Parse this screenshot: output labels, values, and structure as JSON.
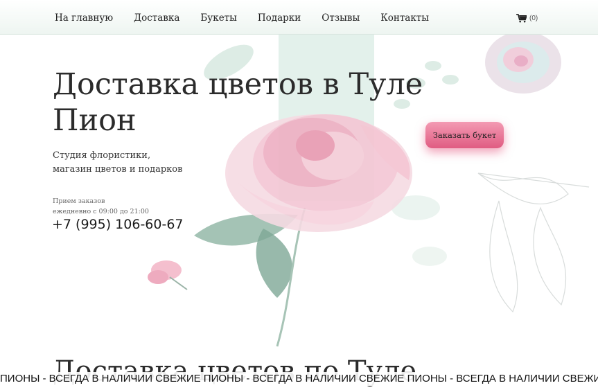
{
  "nav": {
    "items": [
      {
        "label": "На главную"
      },
      {
        "label": "Доставка"
      },
      {
        "label": "Букеты"
      },
      {
        "label": "Подарки"
      },
      {
        "label": "Отзывы"
      },
      {
        "label": "Контакты"
      }
    ],
    "cart_count": "(0)",
    "cart_icon": "shopping-cart-icon"
  },
  "hero": {
    "title_line1": "Доставка цветов в Туле",
    "title_line2": "Пион",
    "subtitle_line1": "Студия флористики,",
    "subtitle_line2": "магазин цветов и подарков",
    "hours_line1": "Прием заказов",
    "hours_line2": "ежедневно с 09:00 до 21:00",
    "phone": "+7 (995) 106-60-67",
    "order_button": "Заказать букет"
  },
  "section": {
    "title": "Доставка цветов по Туле"
  },
  "ticker": {
    "text": "ПИОНЫ - ВСЕГДА В НАЛИЧИИ СВЕЖИЕ ПИОНЫ - ВСЕГДА В НАЛИЧИИ СВЕЖИЕ ПИОНЫ - ВСЕГДА В НАЛИЧИИ СВЕЖИЕ"
  },
  "colors": {
    "accent": "#e8678d",
    "header_bg": "#eef5f1",
    "stripe": "#d7ebe2"
  }
}
